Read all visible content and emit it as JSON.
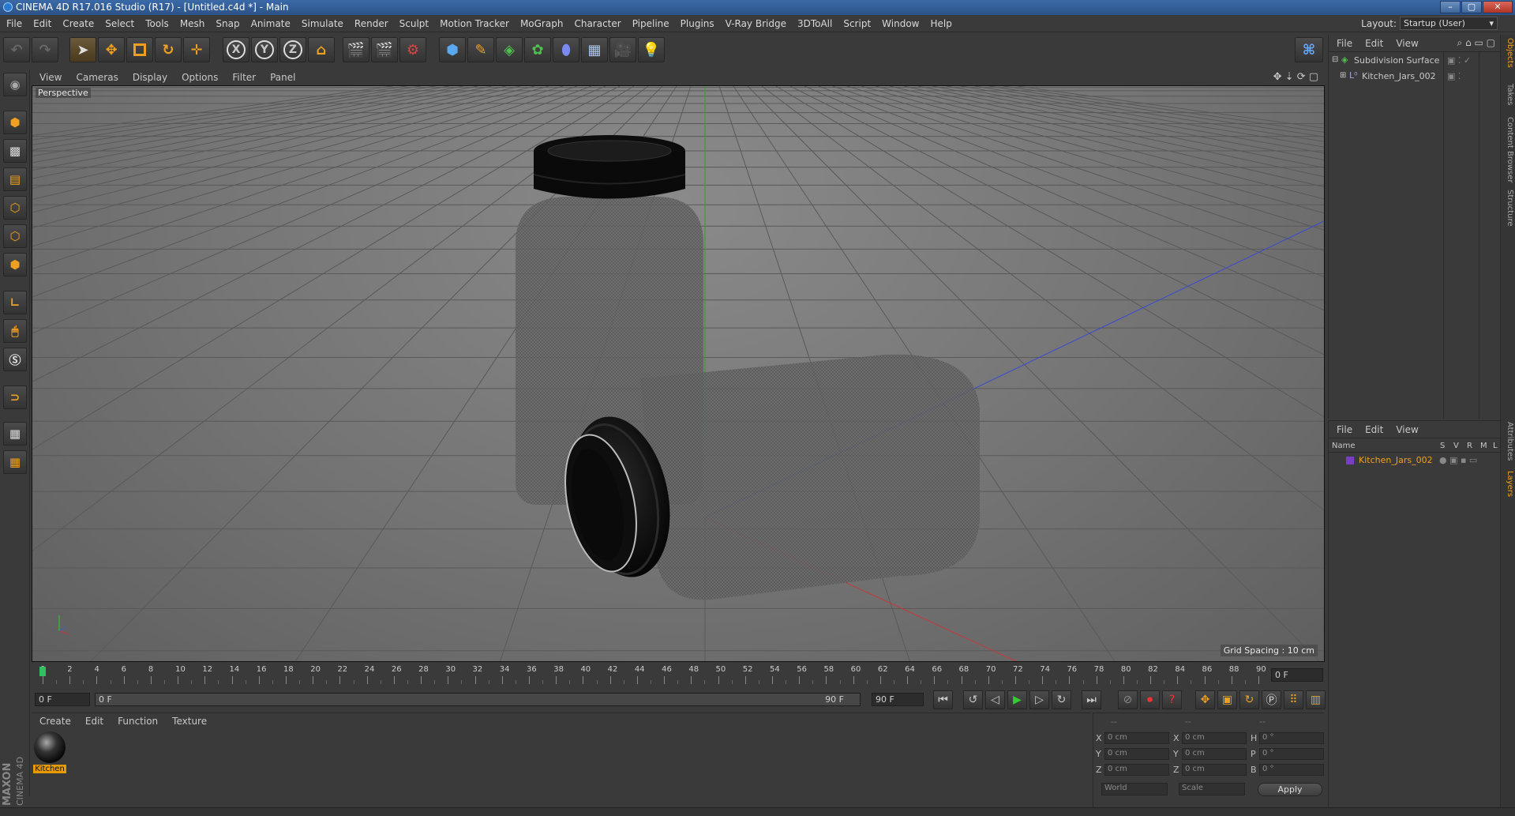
{
  "window": {
    "title": "CINEMA 4D R17.016 Studio (R17) - [Untitled.c4d *] - Main",
    "min": "–",
    "max": "▢",
    "close": "✕"
  },
  "menu": [
    "File",
    "Edit",
    "Create",
    "Select",
    "Tools",
    "Mesh",
    "Snap",
    "Animate",
    "Simulate",
    "Render",
    "Sculpt",
    "Motion Tracker",
    "MoGraph",
    "Character",
    "Pipeline",
    "Plugins",
    "V-Ray Bridge",
    "3DToAll",
    "Script",
    "Window",
    "Help"
  ],
  "layout": {
    "label": "Layout:",
    "value": "Startup (User)"
  },
  "toolbar": {
    "axis_x": "X",
    "axis_y": "Y",
    "axis_z": "Z"
  },
  "viewport": {
    "menu": [
      "View",
      "Cameras",
      "Display",
      "Options",
      "Filter",
      "Panel"
    ],
    "label": "Perspective",
    "grid_spacing": "Grid Spacing : 10 cm"
  },
  "timeline": {
    "ticks": [
      "0",
      "2",
      "4",
      "6",
      "8",
      "10",
      "12",
      "14",
      "16",
      "18",
      "20",
      "22",
      "24",
      "26",
      "28",
      "30",
      "32",
      "34",
      "36",
      "38",
      "40",
      "42",
      "44",
      "46",
      "48",
      "50",
      "52",
      "54",
      "56",
      "58",
      "60",
      "62",
      "64",
      "66",
      "68",
      "70",
      "72",
      "74",
      "76",
      "78",
      "80",
      "82",
      "84",
      "86",
      "88",
      "90"
    ],
    "current_frame": "0 F",
    "start_field": "0 F",
    "range_start": "0 F",
    "range_end": "90 F",
    "end_field": "90 F"
  },
  "materials": {
    "menu": [
      "Create",
      "Edit",
      "Function",
      "Texture"
    ],
    "items": [
      {
        "name": "Kitchen"
      }
    ]
  },
  "coordinates": {
    "header": [
      "--",
      "--",
      "--"
    ],
    "rows": [
      {
        "a": "X",
        "av": "0 cm",
        "b": "X",
        "bv": "0 cm",
        "c": "H",
        "cv": "0 °"
      },
      {
        "a": "Y",
        "av": "0 cm",
        "b": "Y",
        "bv": "0 cm",
        "c": "P",
        "cv": "0 °"
      },
      {
        "a": "Z",
        "av": "0 cm",
        "b": "Z",
        "bv": "0 cm",
        "c": "B",
        "cv": "0 °"
      }
    ],
    "world": "World",
    "scale": "Scale",
    "apply": "Apply"
  },
  "objects": {
    "menu": [
      "File",
      "Edit",
      "View"
    ],
    "items": [
      {
        "name": "Subdivision Surface"
      },
      {
        "name": "Kitchen_Jars_002"
      }
    ]
  },
  "layers": {
    "menu": [
      "File",
      "Edit",
      "View"
    ],
    "columns": {
      "name": "Name",
      "s": "S",
      "v": "V",
      "r": "R",
      "m": "M",
      "l": "L"
    },
    "items": [
      {
        "name": "Kitchen_Jars_002",
        "color": "#7a3fc0"
      }
    ]
  },
  "right_tabs": [
    "Objects",
    "Takes",
    "Content Browser",
    "Structure",
    "Attributes",
    "Layers"
  ],
  "logo": {
    "line1": "MAXON",
    "line2": "CINEMA 4D"
  },
  "colors": {
    "accent": "#f0a020",
    "selection": "#e89a00",
    "x_axis": "#d03030",
    "y_axis": "#30b030",
    "z_axis": "#3050d0"
  }
}
